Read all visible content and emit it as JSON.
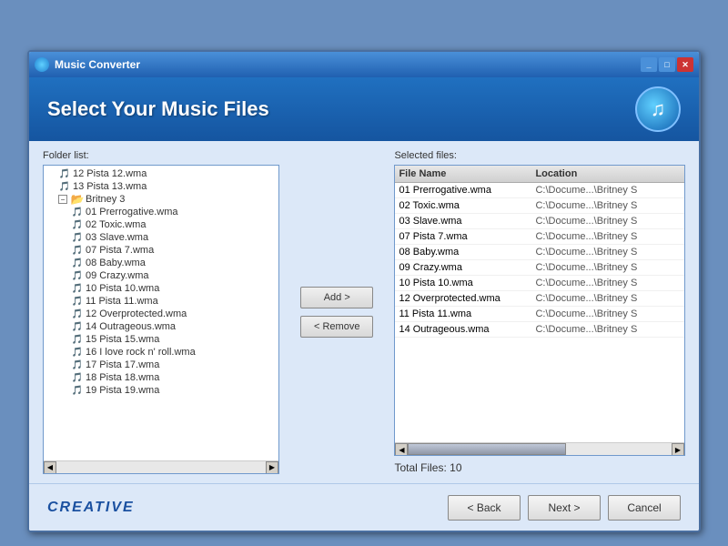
{
  "window": {
    "title": "Music Converter",
    "title_icon": "🎵"
  },
  "header": {
    "title": "Select Your Music Files",
    "logo_icon": "♪"
  },
  "folder_list": {
    "label": "Folder list:",
    "items": [
      {
        "indent": 1,
        "icon": "file",
        "name": "12 Pista 12.wma"
      },
      {
        "indent": 1,
        "icon": "file",
        "name": "13 Pista 13.wma"
      },
      {
        "indent": 1,
        "icon": "folder-open",
        "name": "Britney 3",
        "expanded": true
      },
      {
        "indent": 2,
        "icon": "file",
        "name": "01 Prerrogative.wma"
      },
      {
        "indent": 2,
        "icon": "file",
        "name": "02 Toxic.wma"
      },
      {
        "indent": 2,
        "icon": "file",
        "name": "03 Slave.wma"
      },
      {
        "indent": 2,
        "icon": "file",
        "name": "07 Pista 7.wma"
      },
      {
        "indent": 2,
        "icon": "file",
        "name": "08 Baby.wma"
      },
      {
        "indent": 2,
        "icon": "file",
        "name": "09 Crazy.wma"
      },
      {
        "indent": 2,
        "icon": "file",
        "name": "10 Pista 10.wma"
      },
      {
        "indent": 2,
        "icon": "file",
        "name": "11 Pista 11.wma"
      },
      {
        "indent": 2,
        "icon": "file",
        "name": "12 Overprotected.wma"
      },
      {
        "indent": 2,
        "icon": "file",
        "name": "14 Outrageous.wma"
      },
      {
        "indent": 2,
        "icon": "file",
        "name": "15 Pista 15.wma"
      },
      {
        "indent": 2,
        "icon": "file",
        "name": "16 I love rock n' roll.wma"
      },
      {
        "indent": 2,
        "icon": "file",
        "name": "17 Pista 17.wma"
      },
      {
        "indent": 2,
        "icon": "file",
        "name": "18 Pista 18.wma"
      },
      {
        "indent": 2,
        "icon": "file",
        "name": "19 Pista 19.wma"
      }
    ]
  },
  "buttons": {
    "add_label": "Add >",
    "remove_label": "< Remove"
  },
  "selected_files": {
    "label": "Selected files:",
    "col_filename": "File Name",
    "col_location": "Location",
    "rows": [
      {
        "name": "01 Prerrogative.wma",
        "location": "C:\\Docume...\\Britney S"
      },
      {
        "name": "02 Toxic.wma",
        "location": "C:\\Docume...\\Britney S"
      },
      {
        "name": "03 Slave.wma",
        "location": "C:\\Docume...\\Britney S"
      },
      {
        "name": "07 Pista 7.wma",
        "location": "C:\\Docume...\\Britney S"
      },
      {
        "name": "08 Baby.wma",
        "location": "C:\\Docume...\\Britney S"
      },
      {
        "name": "09 Crazy.wma",
        "location": "C:\\Docume...\\Britney S"
      },
      {
        "name": "10 Pista 10.wma",
        "location": "C:\\Docume...\\Britney S"
      },
      {
        "name": "12 Overprotected.wma",
        "location": "C:\\Docume...\\Britney S"
      },
      {
        "name": "11 Pista 11.wma",
        "location": "C:\\Docume...\\Britney S"
      },
      {
        "name": "14 Outrageous.wma",
        "location": "C:\\Docume...\\Britney S"
      }
    ]
  },
  "total_files": {
    "label": "Total Files: 10"
  },
  "footer": {
    "creative_label": "CREATIVE",
    "back_label": "< Back",
    "next_label": "Next >",
    "cancel_label": "Cancel"
  }
}
